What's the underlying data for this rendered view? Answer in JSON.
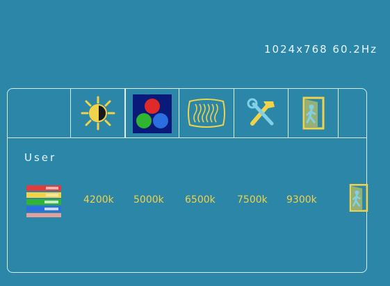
{
  "resolution_text": "1024x768 60.2Hz",
  "tabs": [
    {
      "icon": "blank-icon",
      "selected": false
    },
    {
      "icon": "brightness-sun-icon",
      "selected": false
    },
    {
      "icon": "color-rgb-icon",
      "selected": true
    },
    {
      "icon": "wave-image-icon",
      "selected": false
    },
    {
      "icon": "tools-icon",
      "selected": false
    },
    {
      "icon": "exit-door-icon",
      "selected": false
    },
    {
      "icon": "blank-icon",
      "selected": false
    }
  ],
  "color_menu": {
    "title": "User",
    "options": [
      "4200k",
      "5000k",
      "6500k",
      "7500k",
      "9300k"
    ]
  },
  "colors": {
    "background": "#2c86a8",
    "text_white": "#e8f6fb",
    "text_yellow": "#f0d34a",
    "border": "#d6eef7"
  }
}
